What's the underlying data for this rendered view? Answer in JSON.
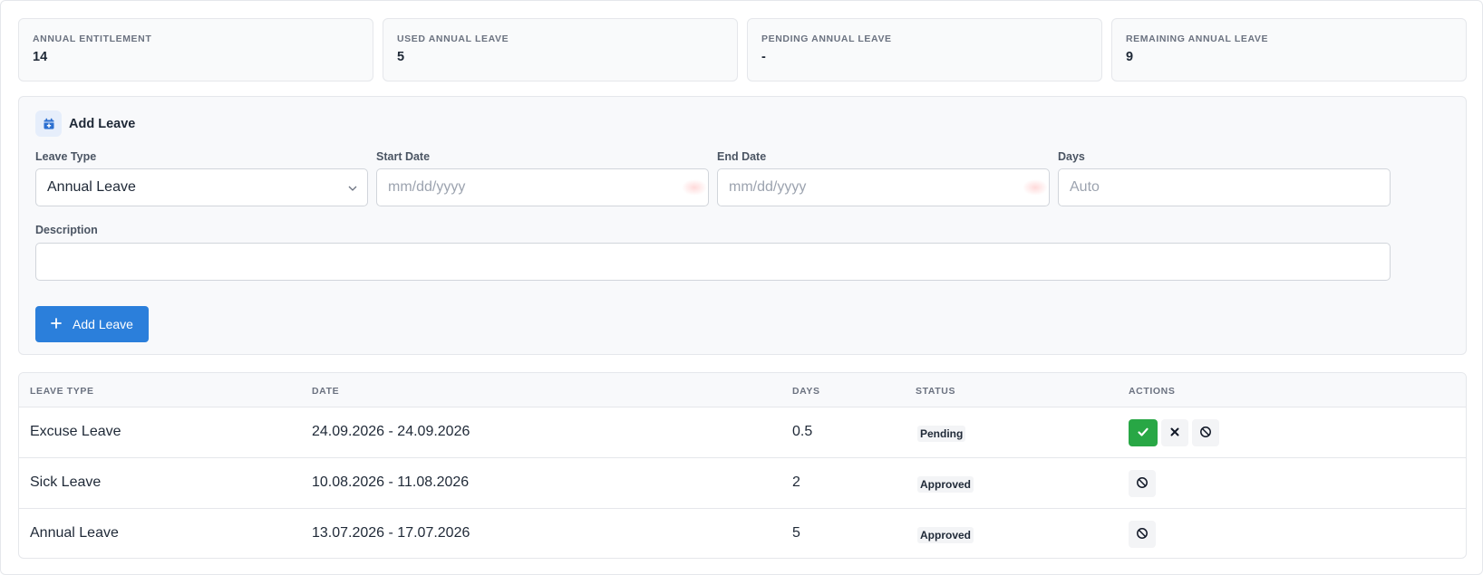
{
  "stats": [
    {
      "label": "ANNUAL ENTITLEMENT",
      "value": "14"
    },
    {
      "label": "USED ANNUAL LEAVE",
      "value": "5"
    },
    {
      "label": "PENDING ANNUAL LEAVE",
      "value": "-"
    },
    {
      "label": "REMAINING ANNUAL LEAVE",
      "value": "9"
    }
  ],
  "form": {
    "title": "Add Leave",
    "icon": "calendar-icon",
    "leave_type_label": "Leave Type",
    "leave_type_value": "Annual Leave",
    "start_date_label": "Start Date",
    "start_date_placeholder": "mm/dd/yyyy",
    "end_date_label": "End Date",
    "end_date_placeholder": "mm/dd/yyyy",
    "days_label": "Days",
    "days_placeholder": "Auto",
    "description_label": "Description",
    "description_value": "",
    "submit_label": "Add Leave"
  },
  "table": {
    "headers": [
      "LEAVE TYPE",
      "DATE",
      "DAYS",
      "STATUS",
      "ACTIONS"
    ],
    "rows": [
      {
        "type": "Excuse Leave",
        "date": "24.09.2026 - 24.09.2026",
        "days": "0.5",
        "status": "Pending",
        "actions": [
          "approve",
          "reject",
          "cancel"
        ]
      },
      {
        "type": "Sick Leave",
        "date": "10.08.2026 - 11.08.2026",
        "days": "2",
        "status": "Approved",
        "actions": [
          "cancel"
        ]
      },
      {
        "type": "Annual Leave",
        "date": "13.07.2026 - 17.07.2026",
        "days": "5",
        "status": "Approved",
        "actions": [
          "cancel"
        ]
      }
    ]
  },
  "colors": {
    "primary": "#2b7fdb",
    "approve": "#28a745",
    "card_bg": "#f8f9fb",
    "border": "#e5e7eb"
  }
}
